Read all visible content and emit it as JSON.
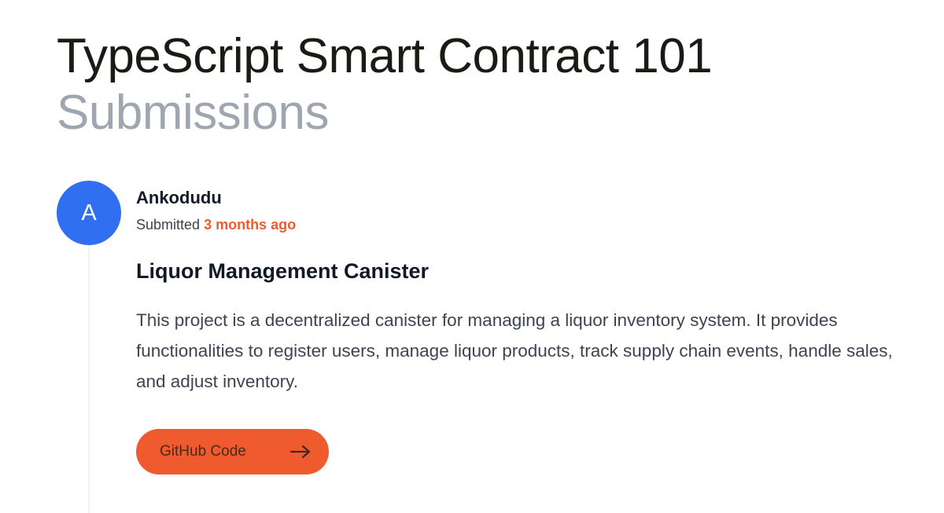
{
  "header": {
    "title": "TypeScript Smart Contract 101",
    "subtitle": "Submissions"
  },
  "submission": {
    "avatar_initial": "A",
    "author": "Ankodudu",
    "submitted_label": "Submitted",
    "submitted_time": "3 months ago",
    "project_title": "Liquor Management Canister",
    "description": "This project is a decentralized canister for managing a liquor inventory system. It provides functionalities to register users, manage liquor products, track supply chain events, handle sales, and adjust inventory.",
    "button_label": "GitHub Code",
    "button_icon": "arrow-right-icon"
  },
  "colors": {
    "accent": "#ef5a2f",
    "avatar": "#2f6ff0",
    "title": "#1c1a14",
    "subtitle": "#a0a6b0"
  }
}
